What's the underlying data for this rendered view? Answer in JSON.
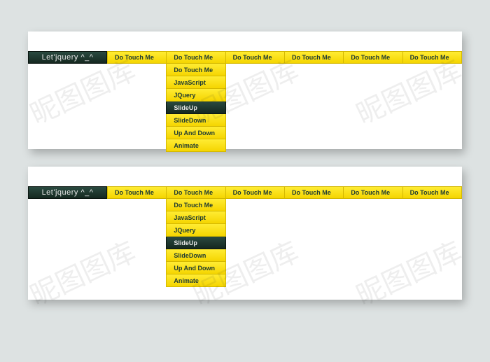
{
  "brand": "Let'jquery   ^_^",
  "menuLabel": "Do Touch Me",
  "menuCount": 6,
  "dropdown": [
    {
      "label": "Do Touch Me",
      "active": false
    },
    {
      "label": "JavaScript",
      "active": false
    },
    {
      "label": "JQuery",
      "active": false
    },
    {
      "label": "SlideUp",
      "active": true
    },
    {
      "label": "SlideDown",
      "active": false
    },
    {
      "label": "Up And Down",
      "active": false
    },
    {
      "label": "Animate",
      "active": false
    }
  ],
  "watermarkText": "昵图图库"
}
